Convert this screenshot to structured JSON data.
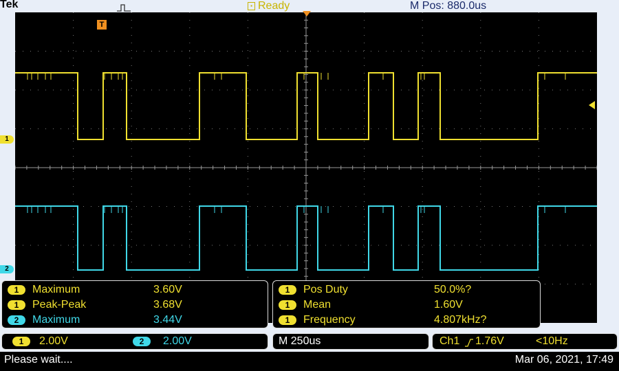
{
  "header": {
    "brand": "Tek",
    "acq_icon": "pulse-trigger-icon",
    "status": "Ready",
    "status_icon": "run-state-icon",
    "mpos": "M Pos: 880.0us"
  },
  "markers": {
    "trigger": "T",
    "ch1": "1",
    "ch2": "2"
  },
  "colors": {
    "ch1": "#f0e030",
    "ch2": "#40d8e8",
    "grid": "#7a7a7a",
    "status": "#c8b400"
  },
  "measurements_left": [
    {
      "ch": "1",
      "name": "Maximum",
      "value": "3.60V"
    },
    {
      "ch": "1",
      "name": "Peak-Peak",
      "value": "3.68V"
    },
    {
      "ch": "2",
      "name": "Maximum",
      "value": "3.44V"
    }
  ],
  "measurements_right": [
    {
      "ch": "1",
      "name": "Pos Duty",
      "value": "50.0%?"
    },
    {
      "ch": "1",
      "name": "Mean",
      "value": "1.60V"
    },
    {
      "ch": "1",
      "name": "Frequency",
      "value": "4.807kHz?"
    }
  ],
  "scale": {
    "ch1_badge": "1",
    "ch1_volts": "2.00V",
    "ch2_badge": "2",
    "ch2_volts": "2.00V",
    "timebase": "M 250us",
    "trigger_source": "Ch1",
    "trigger_level": "1.76V",
    "trigger_freq": "<10Hz"
  },
  "footer": {
    "message": "Please wait....",
    "datetime": "Mar 06, 2021, 17:49"
  }
}
